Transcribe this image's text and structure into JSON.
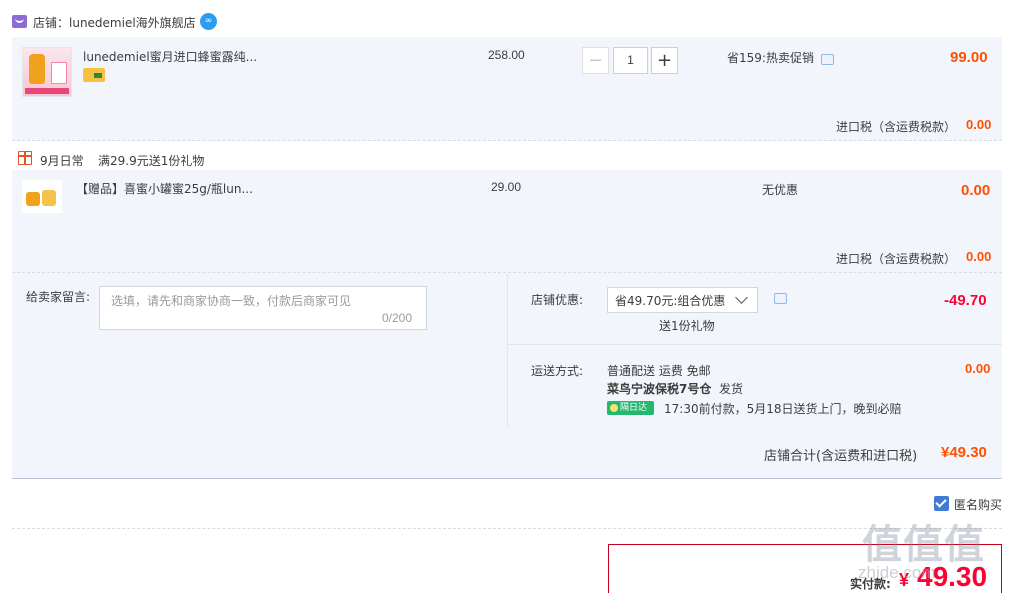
{
  "store": {
    "name": "店铺：lunedemiel海外旗舰店",
    "chat_badge": "∞"
  },
  "items": [
    {
      "title": "lunedemiel蜜月进口蜂蜜露纯...",
      "unit_price": "258.00",
      "quantity": "1",
      "promo": "省159:热卖促销",
      "total": "99.00",
      "tax_label": "进口税（含运费税款）",
      "tax_value": "0.00"
    },
    {
      "title": "【赠品】喜蜜小罐蜜25g/瓶lun...",
      "unit_price": "29.00",
      "promo": "无优惠",
      "total": "0.00",
      "tax_label": "进口税（含运费税款）",
      "tax_value": "0.00"
    }
  ],
  "gift_promo": {
    "event": "9月日常",
    "rule": "满29.9元送1份礼物"
  },
  "qty_controls": {
    "minus": "−",
    "plus": "+"
  },
  "note": {
    "label": "给卖家留言:",
    "placeholder": "选填，请先和商家协商一致，付款后商家可见",
    "counter": "0/200"
  },
  "coupon": {
    "label": "店铺优惠:",
    "selected": "省49.70元:组合优惠",
    "gift": "送1份礼物",
    "amount": "-49.70"
  },
  "shipping": {
    "label": "运送方式:",
    "method": "普通配送 运费 免邮",
    "warehouse": "菜鸟宁波保税7号仓",
    "dispatch": "发货",
    "badge": "隔日达",
    "promise": "17:30前付款，5月18日送货上门，晚到必赔",
    "fee": "0.00"
  },
  "subtotal": {
    "label": "店铺合计(含运费和进口税)",
    "value": "¥49.30"
  },
  "anonymous": {
    "label": "匿名购买",
    "checked": true
  },
  "payment": {
    "label": "实付款:",
    "currency": "¥",
    "value": "49.30"
  },
  "watermark": {
    "glyphs": "值值值",
    "url": "zhide.com"
  },
  "colors": {
    "accent_orange": "#ff5000",
    "accent_red": "#ff0036",
    "row_bg": "#f2f6fc",
    "pay_border": "#c7001f"
  }
}
